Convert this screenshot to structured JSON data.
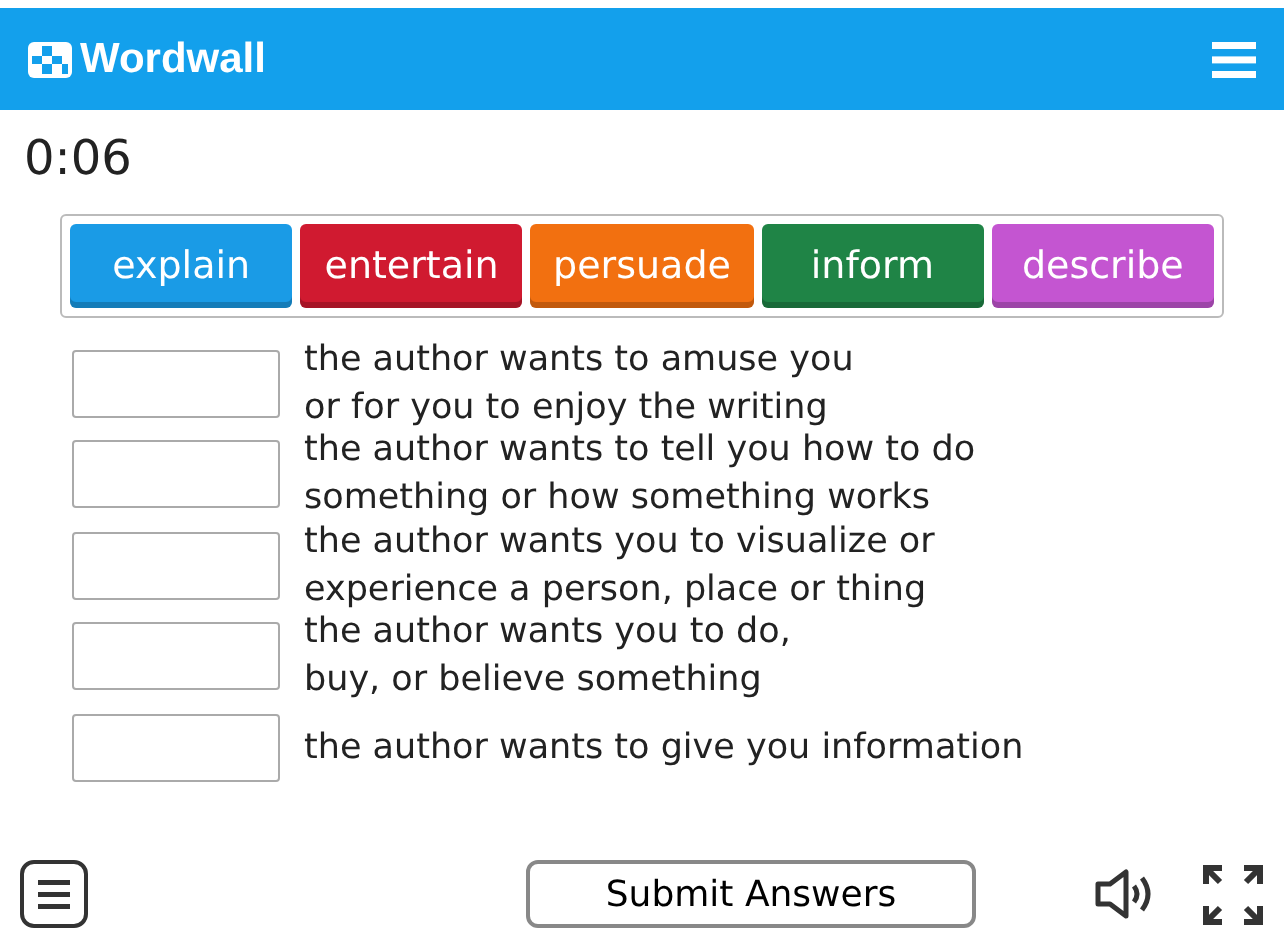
{
  "header": {
    "logo": "Wordwall"
  },
  "timer": "0:06",
  "tiles": [
    {
      "label": "explain",
      "color": "#1a9be6"
    },
    {
      "label": "entertain",
      "color": "#d01a30"
    },
    {
      "label": "persuade",
      "color": "#f27010"
    },
    {
      "label": "inform",
      "color": "#1f8446"
    },
    {
      "label": "describe",
      "color": "#c455d1"
    }
  ],
  "rows": [
    {
      "text": "the author wants to amuse you\nor for you to enjoy the writing"
    },
    {
      "text": "the author wants to tell you how to do\nsomething or how something works"
    },
    {
      "text": "the author wants you to visualize or\nexperience a person, place or thing"
    },
    {
      "text": "the author wants you to do,\nbuy, or believe something"
    },
    {
      "text": "the author wants to give you information"
    }
  ],
  "submit": "Submit Answers"
}
